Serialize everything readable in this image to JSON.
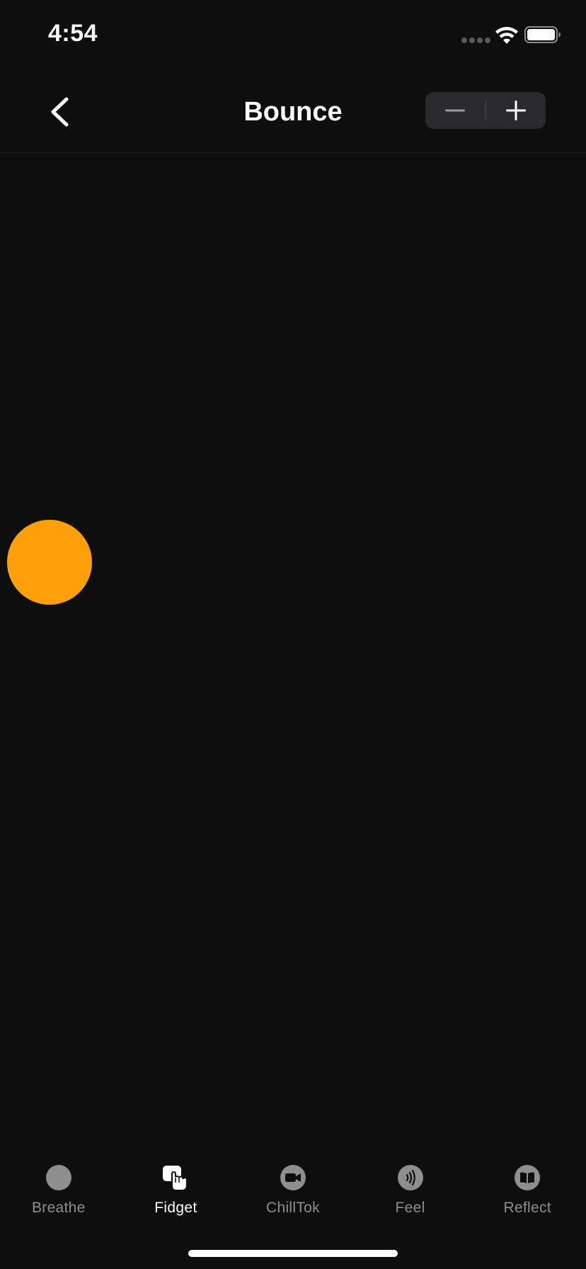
{
  "status_bar": {
    "time": "4:54",
    "icons": [
      "signal-dots-icon",
      "wifi-icon",
      "battery-icon"
    ]
  },
  "header": {
    "title": "Bounce",
    "back_icon": "chevron-left-icon",
    "stepper": {
      "decrement_icon": "minus-icon",
      "increment_icon": "plus-icon"
    }
  },
  "canvas": {
    "ball_color": "#ff9f0a"
  },
  "tabs": [
    {
      "label": "Breathe",
      "icon": "circle-icon",
      "active": false
    },
    {
      "label": "Fidget",
      "icon": "hand-pointer-icon",
      "active": true
    },
    {
      "label": "ChillTok",
      "icon": "video-camera-icon",
      "active": false
    },
    {
      "label": "Feel",
      "icon": "sound-waves-icon",
      "active": false
    },
    {
      "label": "Reflect",
      "icon": "book-icon",
      "active": false
    }
  ],
  "colors": {
    "background": "#0e0e0e",
    "accent": "#ff9f0a",
    "inactive": "#8e8e8e",
    "active": "#ffffff"
  }
}
